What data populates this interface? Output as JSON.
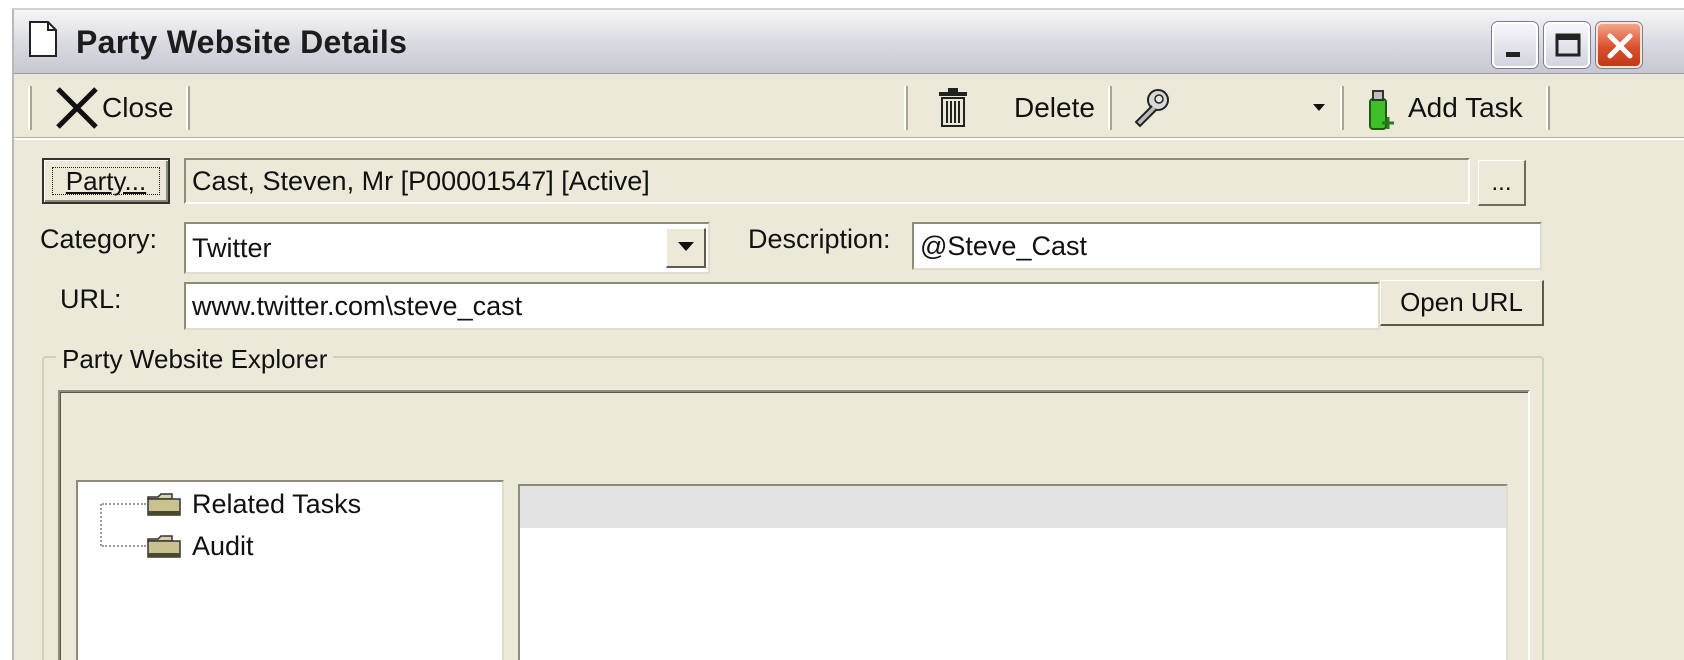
{
  "window": {
    "title": "Party Website Details"
  },
  "toolbar": {
    "close_label": "Close",
    "delete_label": "Delete",
    "add_task_label": "Add Task"
  },
  "party": {
    "button_label": "Party...",
    "value": "Cast, Steven, Mr  [P00001547]  [Active]",
    "ellipsis_label": "..."
  },
  "form": {
    "category_label": "Category:",
    "category_value": "Twitter",
    "description_label": "Description:",
    "description_value": "@Steve_Cast",
    "url_label": "URL:",
    "url_value": "www.twitter.com\\steve_cast",
    "open_url_label": "Open URL"
  },
  "explorer": {
    "group_title": "Party Website Explorer",
    "tree_items": [
      {
        "label": "Related Tasks",
        "icon": "folder-icon"
      },
      {
        "label": "Audit",
        "icon": "folder-icon"
      }
    ]
  },
  "colors": {
    "window_bg": "#ece9d8",
    "close_btn": "#d9502c"
  }
}
